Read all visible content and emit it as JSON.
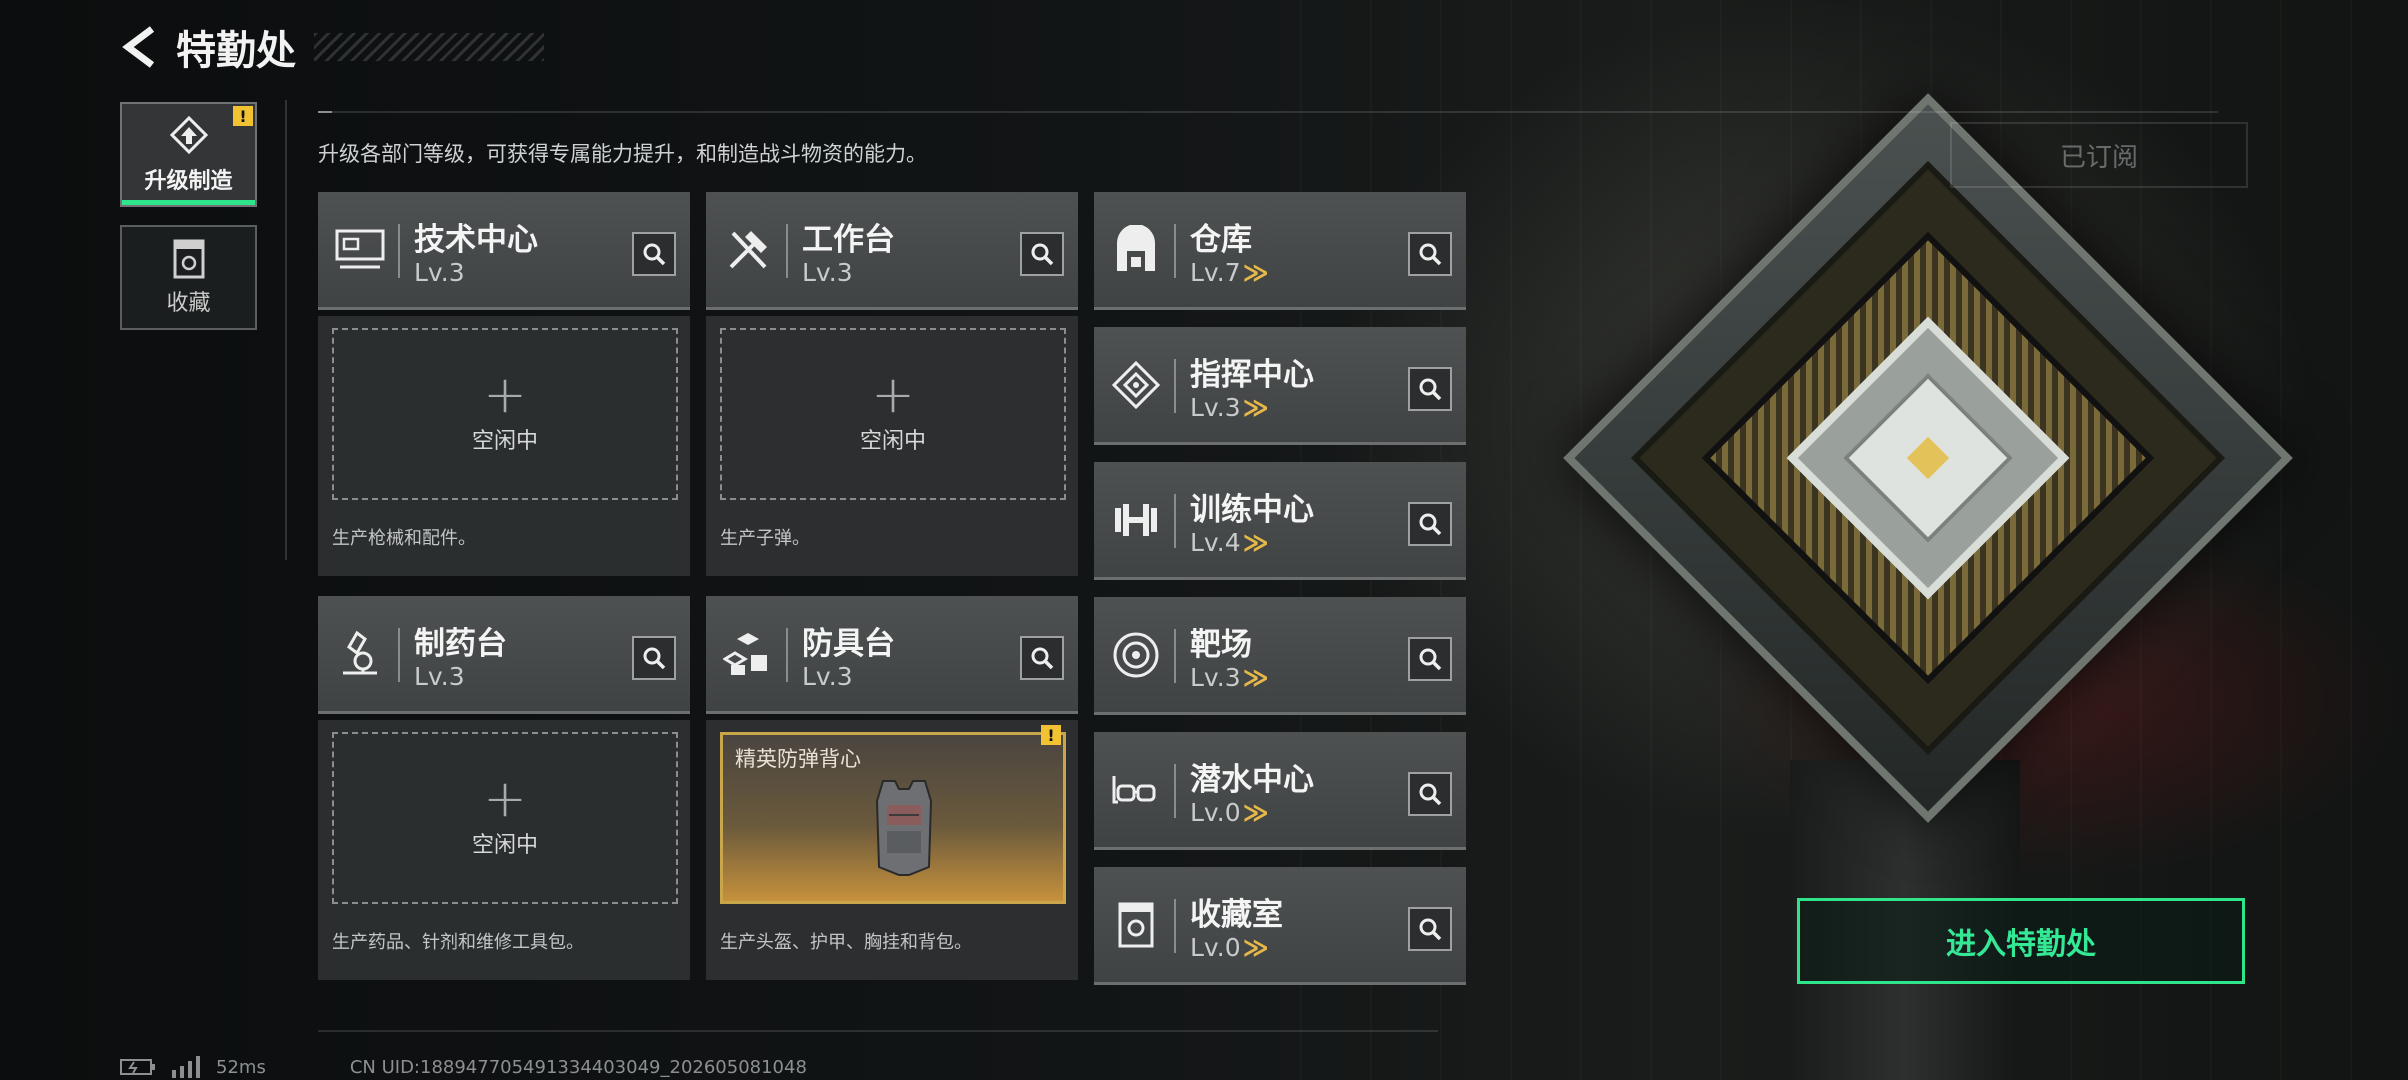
{
  "header": {
    "title": "特勤处"
  },
  "sidebar": {
    "items": [
      {
        "label": "升级制造",
        "active": true,
        "alert": "!"
      },
      {
        "label": "收藏",
        "active": false
      }
    ]
  },
  "description": "升级各部门等级，可获得专属能力提升，和制造战斗物资的能力。",
  "facilities": {
    "tech_center": {
      "name": "技术中心",
      "level": "Lv.3",
      "slot_status": "空闲中",
      "slot_plus": "+",
      "note": "生产枪械和配件。",
      "icon": "computer-icon"
    },
    "workbench": {
      "name": "工作台",
      "level": "Lv.3",
      "slot_status": "空闲中",
      "slot_plus": "+",
      "note": "生产子弹。",
      "icon": "tools-icon"
    },
    "pharmacy": {
      "name": "制药台",
      "level": "Lv.3",
      "slot_status": "空闲中",
      "slot_plus": "+",
      "note": "生产药品、针剂和维修工具包。",
      "icon": "microscope-icon"
    },
    "armor_bench": {
      "name": "防具台",
      "level": "Lv.3",
      "item_name": "精英防弹背心",
      "alert": "!",
      "note": "生产头盔、护甲、胸挂和背包。",
      "icon": "cubes-icon"
    },
    "warehouse": {
      "name": "仓库",
      "level": "Lv.7",
      "icon": "warehouse-icon"
    },
    "command_center": {
      "name": "指挥中心",
      "level": "Lv.3",
      "icon": "command-icon"
    },
    "training_center": {
      "name": "训练中心",
      "level": "Lv.4",
      "icon": "dumbbell-icon"
    },
    "shooting_range": {
      "name": "靶场",
      "level": "Lv.3",
      "icon": "target-icon"
    },
    "diving_center": {
      "name": "潜水中心",
      "level": "Lv.0",
      "icon": "goggles-icon"
    },
    "collection_room": {
      "name": "收藏室",
      "level": "Lv.0",
      "icon": "display-case-icon"
    }
  },
  "upgrade_chevron": "≫",
  "right_panel": {
    "subscribed_label": "已订阅",
    "enter_button": "进入特勤处"
  },
  "status_bar": {
    "ping": "52ms",
    "uid": "CN UID:18894770549133440304​9_202605081048"
  },
  "colors": {
    "accent_green": "#2ee58c",
    "upgrade_gold": "#e6b84a",
    "alert_yellow": "#f1c232"
  }
}
